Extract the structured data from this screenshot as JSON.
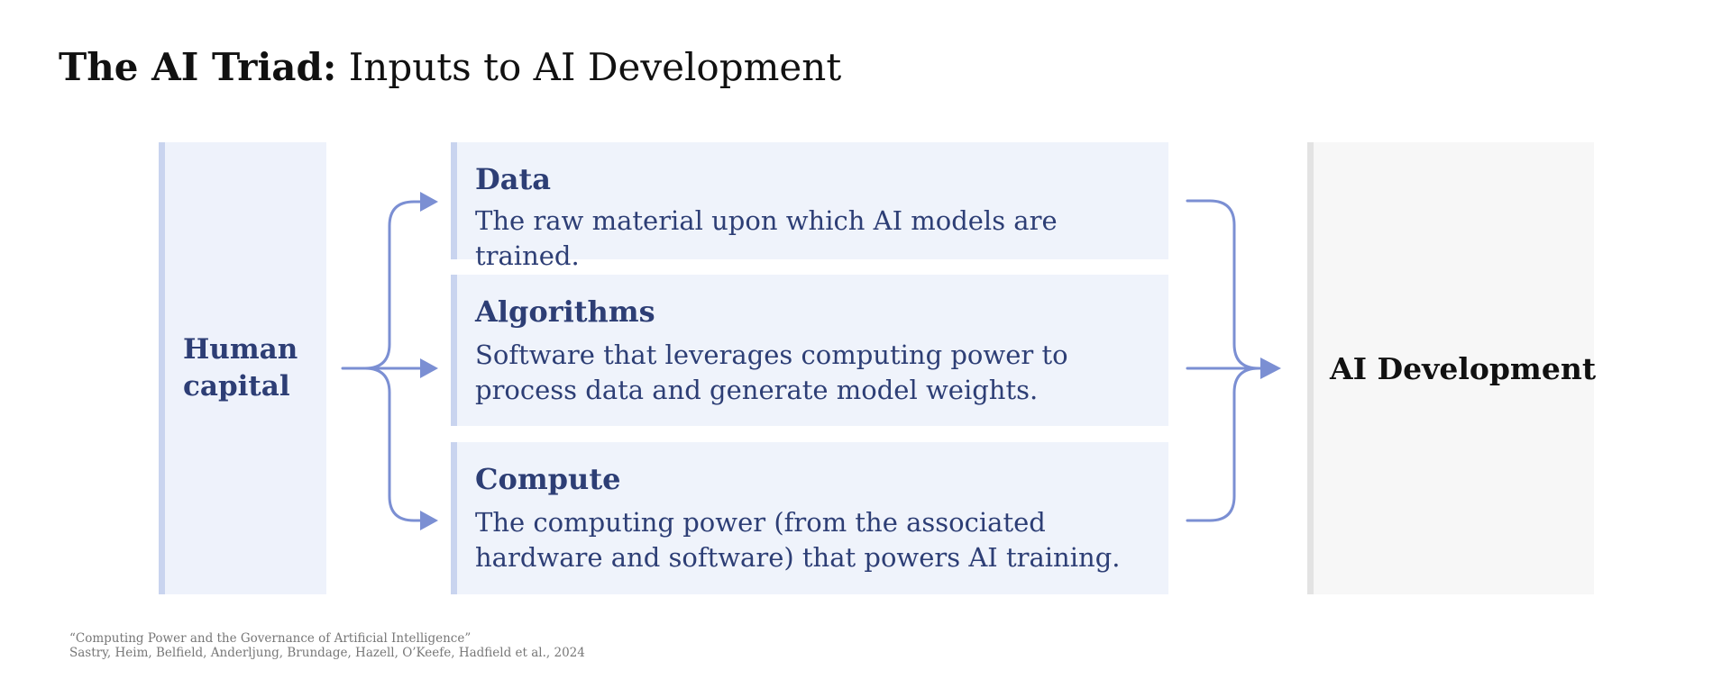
{
  "title": {
    "bold": "The AI Triad:",
    "regular": "Inputs to AI Development"
  },
  "left": {
    "label_line1": "Human",
    "label_line2": "capital"
  },
  "inputs": [
    {
      "heading": "Data",
      "description": "The raw material upon which AI models are trained."
    },
    {
      "heading": "Algorithms",
      "description": "Software that leverages computing power to process data and generate model weights."
    },
    {
      "heading": "Compute",
      "description": "The computing power (from the associated hardware and software) that powers AI training."
    }
  ],
  "output": {
    "label": "AI Development"
  },
  "citation": {
    "line1": "“Computing Power and the Governance of Artificial Intelligence”",
    "line2": "Sastry, Heim, Belfield, Anderljung, Brundage, Hazell, O’Keefe, Hadfield et al., 2024"
  },
  "colors": {
    "arrow": "#7b8fd3",
    "text_dark_blue": "#2d3e75",
    "box_fill": "#eff3fb",
    "box_accent": "#c9d4ef",
    "output_fill": "#f7f7f7"
  }
}
